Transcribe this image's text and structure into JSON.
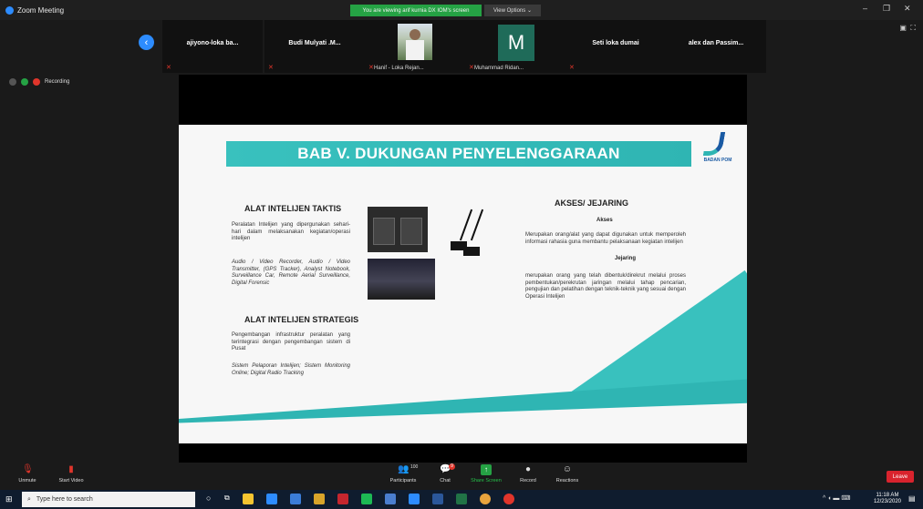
{
  "window": {
    "title": "Zoom Meeting",
    "viewing_banner": "You are viewing arif kurnia DX IOM's screen",
    "view_options": "View Options ⌄",
    "minimize": "–",
    "restore": "❐",
    "close": "✕"
  },
  "participants": [
    {
      "name": "ajiyono-loka ba...",
      "caption": ""
    },
    {
      "name": "Budi Mulyati .M...",
      "caption": ""
    },
    {
      "name": "",
      "caption": "Hanif - Loka Rejan..."
    },
    {
      "name": "",
      "caption": "Muhammad Ridan...",
      "initial": "M"
    },
    {
      "name": "Seti loka dumai",
      "caption": ""
    },
    {
      "name": "alex dan Passim...",
      "caption": ""
    }
  ],
  "recording": {
    "label": "Recording"
  },
  "slide": {
    "title": "BAB V. DUKUNGAN PENYELENGGARAAN",
    "logo_text": "BADAN POM",
    "left": {
      "heading1": "ALAT INTELIJEN TAKTIS",
      "para1": "Peralatan Intelijen yang dipergunakan sehari-hari dalam melaksanakan kegiatan/operasi intelijen",
      "para2": "Audio / Video Recorder, Audio / Video Transmitter, (GPS Tracker), Analyst Notebook, Surveillance Car, Remote Aerial Surveillance, Digital Forensic",
      "heading2": "ALAT INTELIJEN STRATEGIS",
      "para3": "Pengembangan infrastruktur peralatan yang terintegrasi dengan pengembangan sistem di Pusat",
      "para4": "Sistem Pelaporan Intelijen; Sistem Monitoring Online; Digital Radio Tracking"
    },
    "right": {
      "heading": "AKSES/ JEJARING",
      "sub1": "Akses",
      "para1": "Merupakan orang/alat yang dapat digunakan untuk memperoleh informasi rahasia guna membantu pelaksanaan kegiatan intelijen",
      "sub2": "Jejaring",
      "para2": "merupakan orang yang telah dibentuk/direkrut melalui proses pembentukan/perekrutan jaringan melalui tahap pencarian, pengujian dan pelatihan dengan teknik-teknik yang sesuai dengan Operasi Intelijen"
    }
  },
  "controls": {
    "unmute": "Unmute",
    "start_video": "Start Video",
    "participants": "Participants",
    "participants_count": "100",
    "chat": "Chat",
    "chat_badge": "9",
    "share_screen": "Share Screen",
    "record": "Record",
    "reactions": "Reactions",
    "leave": "Leave"
  },
  "taskbar": {
    "search_placeholder": "Type here to search",
    "time": "11:18 AM",
    "date": "12/23/2020"
  },
  "colors": {
    "accent": "#2fb5b3",
    "zoom_blue": "#2d8cff",
    "share_green": "#25a244",
    "leave_red": "#d9232d"
  }
}
